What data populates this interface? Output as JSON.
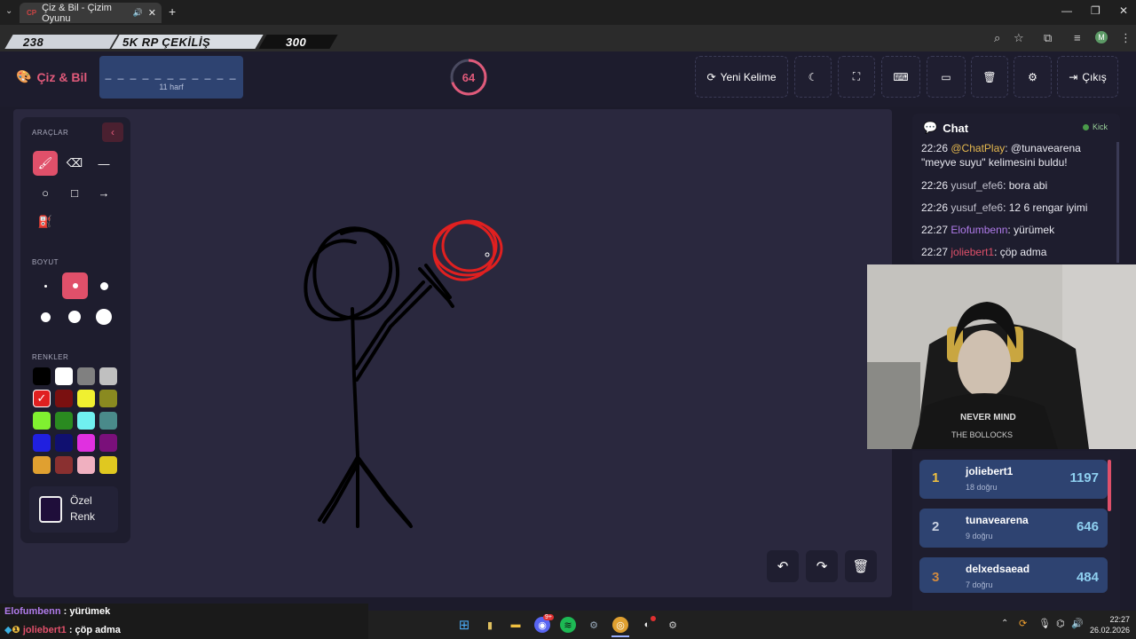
{
  "browser": {
    "tab_title": "Çiz & Bil - Çizim Oyunu",
    "tab_favicon": "CP",
    "new_tab": "+"
  },
  "stream_overlay": {
    "left_count": "238",
    "title": "5K RP ÇEKİLİŞ",
    "right_count": "300"
  },
  "header": {
    "logo": "Çiz & Bil",
    "word_dashes": "_ _ _ _ _ _ _ _ _ _ _",
    "word_hint": "11 harf",
    "timer": "64",
    "timer_fraction": 0.7,
    "new_word": "Yeni Kelime",
    "logout": "Çıkış"
  },
  "tools": {
    "section_tools": "ARAÇLAR",
    "section_size": "BOYUT",
    "section_colors": "RENKLER",
    "custom_color_line1": "Özel",
    "custom_color_line2": "Renk",
    "colors": [
      "#000000",
      "#ffffff",
      "#808080",
      "#c0c0c0",
      "#e02020",
      "#7a1010",
      "#f0f030",
      "#8a8a20",
      "#80f030",
      "#2a8a20",
      "#70f0f0",
      "#4a8a8a",
      "#2020e0",
      "#101070",
      "#e030e0",
      "#7a107a",
      "#e0a030",
      "#8a3030",
      "#f0b0c0",
      "#e0c820"
    ]
  },
  "chat": {
    "title": "Chat",
    "status": "Kick",
    "messages": [
      {
        "time": "22:26",
        "user": "@ChatPlay",
        "text": ": @tunavearena \"meyve suyu\" kelimesini buldu!"
      },
      {
        "time": "22:26",
        "user": "yusuf_efe6",
        "text": ": bora abi"
      },
      {
        "time": "22:26",
        "user": "yusuf_efe6",
        "text": ": 12 6 rengar iyimi"
      },
      {
        "time": "22:27",
        "user": "Elofumbenn",
        "text": ": yürümek"
      },
      {
        "time": "22:27",
        "user": "joliebert1",
        "text": ": çöp adma"
      }
    ]
  },
  "leaderboard": [
    {
      "rank": "1",
      "name": "joliebert1",
      "sub": "18 doğru",
      "score": "1197"
    },
    {
      "rank": "2",
      "name": "tunavearena",
      "sub": "9 doğru",
      "score": "646"
    },
    {
      "rank": "3",
      "name": "delxedsaead",
      "sub": "7 doğru",
      "score": "484"
    }
  ],
  "bottom_chat": [
    {
      "user": "Elofumbenn",
      "text": " : yürümek"
    },
    {
      "user": "joliebert1",
      "text": " : çöp adma"
    }
  ],
  "taskbar": {
    "time": "22:27",
    "date": "26.02.2026",
    "discord_badge": "9+"
  },
  "webcam_text": {
    "shirt_line1": "NEVER MIND",
    "shirt_line2": "THE BOLLOCKS"
  }
}
